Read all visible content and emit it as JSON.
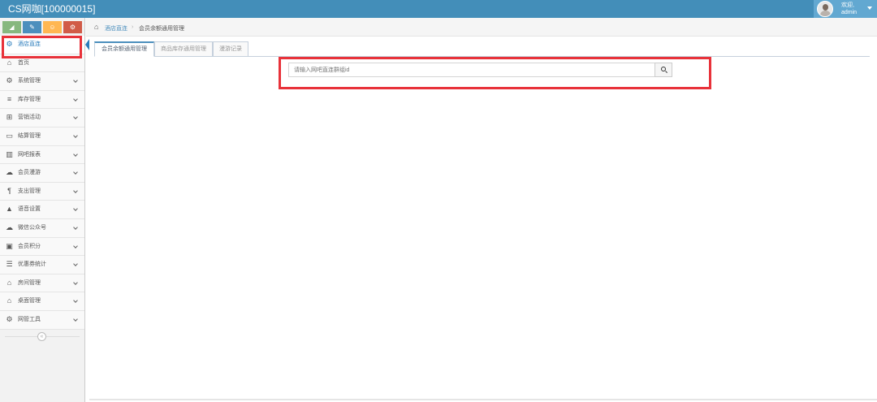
{
  "app": {
    "title": "CS网咖[100000015]"
  },
  "user": {
    "greeting": "欢迎,",
    "name": "admin"
  },
  "shortcuts": [
    {
      "icon": "signal-icon",
      "color": "#87b87f"
    },
    {
      "icon": "pencil-icon",
      "color": "#4c8fbd"
    },
    {
      "icon": "users-icon",
      "color": "#ffb752"
    },
    {
      "icon": "cogs-icon",
      "color": "#d15b47"
    }
  ],
  "sidebar": {
    "items": [
      {
        "label": "酒店直连",
        "icon": "gear-icon",
        "glyph": "⚙",
        "active": true
      },
      {
        "label": "首页",
        "icon": "home-icon",
        "glyph": "⌂"
      },
      {
        "label": "系统管理",
        "icon": "gear-icon",
        "glyph": "⚙"
      },
      {
        "label": "库存管理",
        "icon": "database-icon",
        "glyph": "≡"
      },
      {
        "label": "营销活动",
        "icon": "gift-icon",
        "glyph": "⊞"
      },
      {
        "label": "结算管理",
        "icon": "credit-card-icon",
        "glyph": "▭"
      },
      {
        "label": "网吧报表",
        "icon": "bar-chart-icon",
        "glyph": "▥"
      },
      {
        "label": "会员漫游",
        "icon": "cloud-icon",
        "glyph": "☁"
      },
      {
        "label": "支出管理",
        "icon": "cutlery-icon",
        "glyph": "¶"
      },
      {
        "label": "语音设置",
        "icon": "bell-icon",
        "glyph": "▲"
      },
      {
        "label": "微信公众号",
        "icon": "cloud-icon",
        "glyph": "☁"
      },
      {
        "label": "会员积分",
        "icon": "money-icon",
        "glyph": "▣"
      },
      {
        "label": "优惠券统计",
        "icon": "list-icon",
        "glyph": "☰"
      },
      {
        "label": "房间管理",
        "icon": "home-icon",
        "glyph": "⌂"
      },
      {
        "label": "桌面管理",
        "icon": "home-icon",
        "glyph": "⌂"
      },
      {
        "label": "网管工具",
        "icon": "gear-icon",
        "glyph": "⚙"
      }
    ],
    "collapse_glyph": "«"
  },
  "breadcrumb": {
    "link": "酒店直连",
    "current": "会员余额通用管理"
  },
  "tabs": [
    {
      "label": "会员余额通用管理",
      "active": true
    },
    {
      "label": "商品库存通用管理"
    },
    {
      "label": "漫游记录"
    }
  ],
  "search": {
    "placeholder": "请输入网吧直连群组id"
  },
  "colors": {
    "navbar": "#438eb9",
    "highlight": "#e8323a",
    "accent": "#2b7dbc"
  }
}
